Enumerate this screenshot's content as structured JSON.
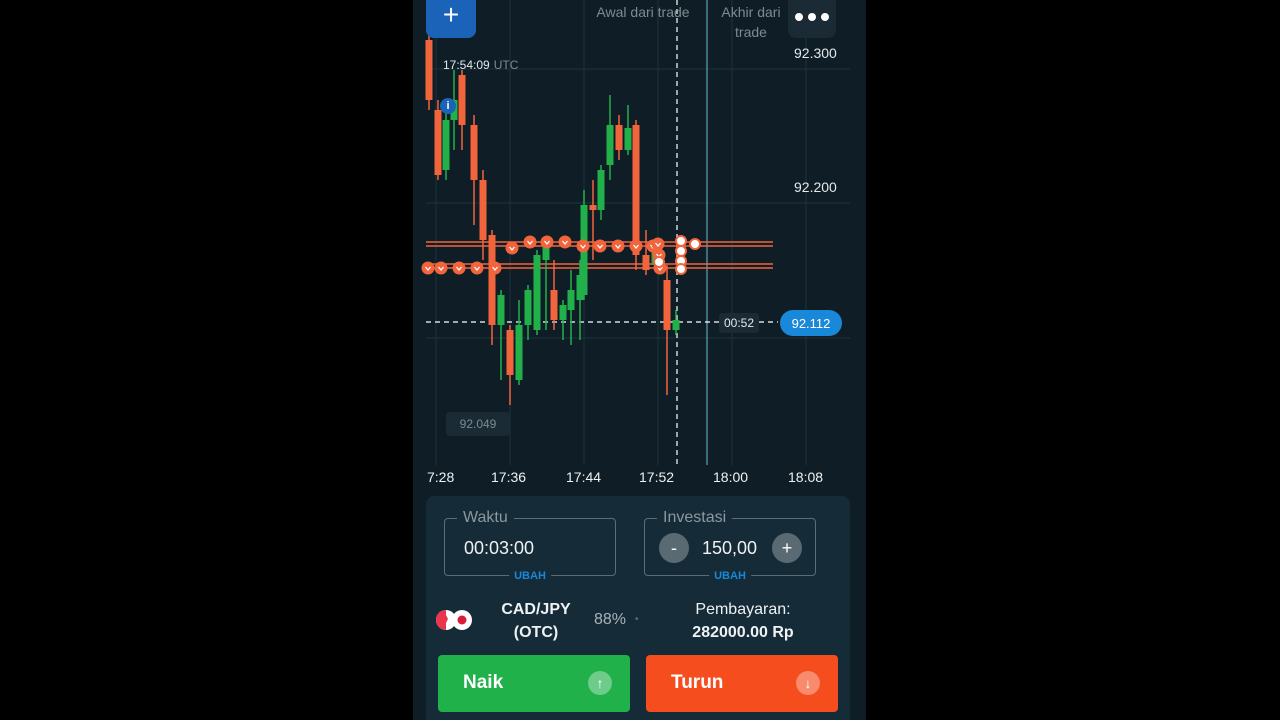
{
  "toolbar": {
    "add_label": "+"
  },
  "chart": {
    "trade_start_label": "Awal dari trade",
    "trade_end_label": "Akhir dari trade",
    "server_time": "17:54:09",
    "timezone": "UTC",
    "info_label": "i",
    "price_labels": [
      "92.300",
      "92.200"
    ],
    "min_price": "92.049",
    "countdown": "00:52",
    "current_price": "92.112",
    "time_labels": [
      "7:28",
      "17:36",
      "17:44",
      "17:52",
      "18:00",
      "18:08"
    ],
    "colors": {
      "up": "#22b04b",
      "down": "#f2643c",
      "accent": "#1a88d8"
    }
  },
  "trade_panel": {
    "duration": {
      "label": "Waktu",
      "value": "00:03:00",
      "action": "UBAH"
    },
    "investment": {
      "label": "Investasi",
      "value": "150,00",
      "minus": "-",
      "plus": "+",
      "action": "UBAH"
    },
    "asset": {
      "name": "CAD/JPY (OTC)",
      "payout_percent": "88%",
      "dot": "•"
    },
    "payout": {
      "label": "Pembayaran:",
      "amount": "282000.00 Rp"
    },
    "buttons": {
      "up_label": "Naik",
      "up_icon": "↑",
      "down_label": "Turun",
      "down_icon": "↓"
    }
  }
}
